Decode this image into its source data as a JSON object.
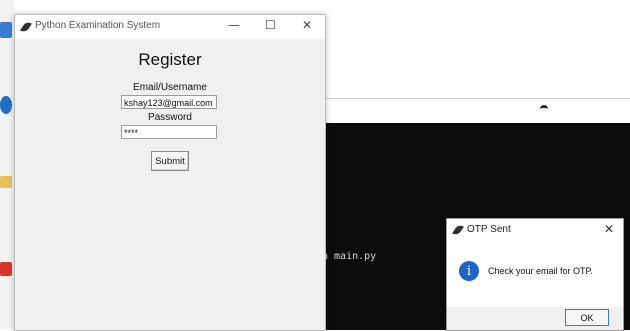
{
  "main_window": {
    "title": "Python Examination System",
    "controls": {
      "minimize": "—",
      "maximize": "☐",
      "close": "✕"
    },
    "heading": "Register",
    "email_label": "Email/Username",
    "email_value": "kshay123@gmail.com",
    "password_label": "Password",
    "password_value": "****",
    "submit_label": "Submit"
  },
  "terminal": {
    "visible_text": "n main.py"
  },
  "dialog": {
    "title": "OTP Sent",
    "close": "✕",
    "message": "Check your email for OTP.",
    "icon": "info-icon",
    "ok_label": "OK"
  },
  "colors": {
    "info_icon": "#1e66c6",
    "terminal_bg": "#0c0c0c",
    "ok_border": "#3c7bd4"
  }
}
